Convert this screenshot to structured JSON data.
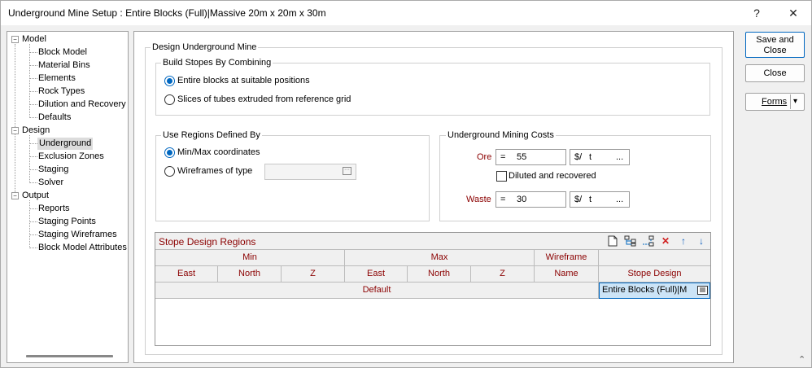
{
  "window": {
    "title": "Underground Mine Setup : Entire Blocks (Full)|Massive 20m x 20m x 30m",
    "help": "?",
    "close": "✕"
  },
  "tree": {
    "model": "Model",
    "model_items": [
      "Block Model",
      "Material Bins",
      "Elements",
      "Rock Types",
      "Dilution and Recovery",
      "Defaults"
    ],
    "design": "Design",
    "design_items": [
      "Underground",
      "Exclusion Zones",
      "Staging",
      "Solver"
    ],
    "output": "Output",
    "output_items": [
      "Reports",
      "Staging Points",
      "Staging Wireframes",
      "Block Model Attributes"
    ]
  },
  "design_group": {
    "label": "Design Underground Mine"
  },
  "build_stopes": {
    "label": "Build Stopes By Combining",
    "option1": "Entire blocks at suitable positions",
    "option2": "Slices of tubes extruded from reference grid",
    "selected": 1
  },
  "regions": {
    "label": "Use Regions Defined By",
    "option1": "Min/Max coordinates",
    "option2": "Wireframes of type",
    "wireframe_type_value": ""
  },
  "costs": {
    "label": "Underground Mining Costs",
    "ore_label": "Ore",
    "ore_eq": "=",
    "ore_value": "55",
    "ore_unit_prefix": "$/",
    "ore_unit": "t",
    "ore_more": "...",
    "diluted_label": "Diluted and recovered",
    "diluted_checked": false,
    "waste_label": "Waste",
    "waste_eq": "=",
    "waste_value": "30",
    "waste_unit_prefix": "$/",
    "waste_unit": "t",
    "waste_more": "..."
  },
  "grid": {
    "title": "Stope Design Regions",
    "group_headers": {
      "min": "Min",
      "max": "Max",
      "wireframe": "Wireframe"
    },
    "columns": [
      "East",
      "North",
      "Z",
      "East",
      "North",
      "Z",
      "Name",
      "Stope Design"
    ],
    "rows": [
      {
        "label": "Default",
        "stope_design": "Entire Blocks (Full)|M"
      }
    ]
  },
  "buttons": {
    "save_close_1": "Save and",
    "save_close_2": "Close",
    "close": "Close",
    "forms": "Forms",
    "forms_arrow": "▾"
  }
}
